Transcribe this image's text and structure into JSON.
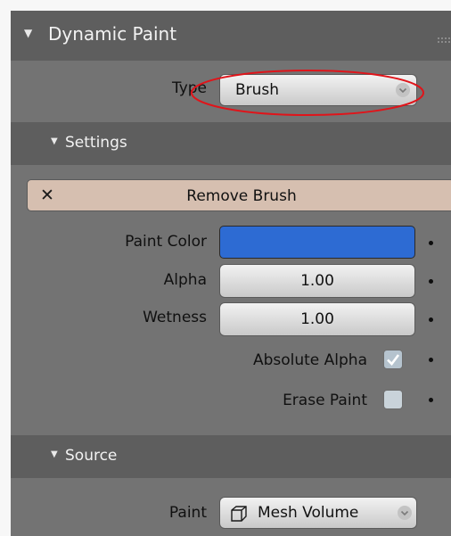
{
  "panel": {
    "title": "Dynamic Paint",
    "type_label": "Type",
    "type_value": "Brush"
  },
  "settings": {
    "title": "Settings",
    "remove_label": "Remove Brush",
    "paint_color_label": "Paint Color",
    "paint_color_value": "#2d6bd3",
    "alpha_label": "Alpha",
    "alpha_value": "1.00",
    "wetness_label": "Wetness",
    "wetness_value": "1.00",
    "absolute_alpha_label": "Absolute Alpha",
    "absolute_alpha_checked": true,
    "erase_paint_label": "Erase Paint",
    "erase_paint_checked": false
  },
  "source": {
    "title": "Source",
    "paint_label": "Paint",
    "paint_value": "Mesh Volume"
  },
  "colors": {
    "panel_bg": "#737373",
    "header_bg": "#5e5e5e",
    "remove_button_bg": "#d6bfb0",
    "annotation_circle": "#e0141a"
  }
}
